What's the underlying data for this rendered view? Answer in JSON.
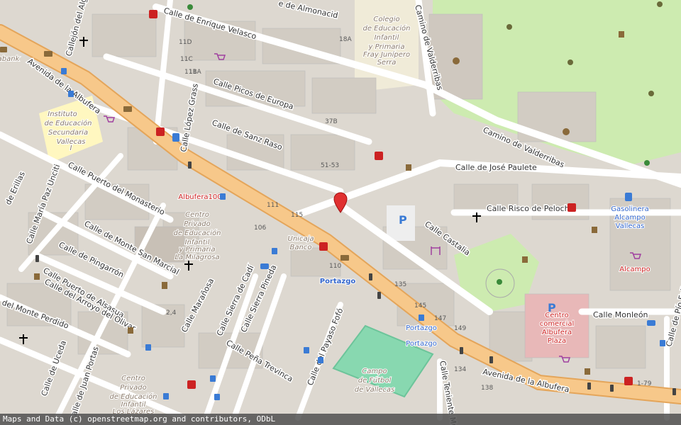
{
  "streets": {
    "albufera": "Avenida de la Albufera",
    "albufera_b": "Avenida de la Albufera",
    "enrique": "Calle de Enrique Velasco",
    "picos": "Calle Picos de Europa",
    "sanz": "Calle de Sanz Raso",
    "puerto_mon": "Calle Puerto del Monasterio",
    "monte_sm": "Calle de Monte San Marcial",
    "pingarron": "Calle de Pingarrón",
    "alsasua": "Calle Puerto de Alsasua",
    "arroyo": "Calle del Arroyo del Olivar",
    "monte_perdido": "del Monte Perdido",
    "uceda": "Calle de Uceda",
    "juan_portas": "Calle de Juan Portas",
    "marañosa": "Calle Marañosa",
    "sierra_cadi": "Calle Sierra de Cadí",
    "sierra_pineda": "Calle Sierra Pineda",
    "pena": "Calle Peña Trevinca",
    "payaso": "Calle del Payaso Fofó",
    "lopez": "Calle López Grass",
    "jose_paulete": "Calle de José Paulete",
    "risco": "Calle Risco de Peloche",
    "castalia": "Calle Castalia",
    "camino_v": "Camino de Valderribas",
    "camino_v2": "Camino de Valderribas",
    "monleon": "Calle Monleón",
    "pio": "Calle de Pío Felipe",
    "erillas": "de Erillas",
    "maria_paz": "Calle María Paz Unciti",
    "almonacid": "e de Almonacid",
    "callejon": "Callejón del Alguacil",
    "teniente": "Calle Teniente Muñoz"
  },
  "pois": {
    "instituto": [
      "Instituto",
      "de Educación",
      "Secundaria",
      "Vallecas",
      "I"
    ],
    "colegio": [
      "Colegio",
      "de Educación",
      "Infantil",
      "y Primaria",
      "Fray Junípero",
      "Serra"
    ],
    "centro_milagrosa": [
      "Centro",
      "Privado",
      "de Educación",
      "Infantil",
      "y Primaria",
      "La Milagrosa"
    ],
    "centro_lazares": [
      "Centro",
      "Privado",
      "de Educación",
      "Infantil",
      "Los Lázares"
    ],
    "campo": [
      "Campo",
      "de Fútbol",
      "de Vallecas"
    ],
    "centro_comercial": [
      "Centro",
      "comercial",
      "Albufera",
      "Plaza"
    ],
    "gasolinera": [
      "Gasolinera",
      "Alcampo",
      "Vallecas"
    ],
    "alcampo": "Alcampo",
    "albufera100": "Albufera100",
    "unicaja": [
      "Unicaja",
      "Banco"
    ],
    "portazgo": "Portazgo",
    "portazgo2": "Portazgo",
    "portazgo3": "Portazgo",
    "bank": "abank"
  },
  "house_numbers": [
    "11D",
    "11C",
    "11B",
    "11A",
    "18A",
    "37B",
    "51-53",
    "111",
    "115",
    "106",
    "110",
    "135",
    "145",
    "147",
    "149",
    "134",
    "138",
    "1-79",
    "2,4"
  ],
  "attribution": "Maps and Data (c) openstreetmap.org and contributors, ODbL",
  "colors": {
    "background": "#ddd8d0",
    "main_road": "#f7c88a",
    "road": "#ffffff",
    "park": "#cdebb0",
    "pitch": "#88d8b0",
    "school": "#fff7c0",
    "marker": "#e03030"
  },
  "marker": "location-pin"
}
